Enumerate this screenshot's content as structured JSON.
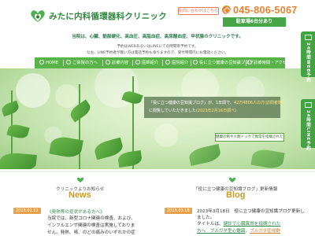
{
  "header": {
    "clinic_name": "みたに内科循環器科クリニック",
    "contact_label": "お問い合わせはこちら",
    "phone": "045-806-5067",
    "parking": "駐車場6台分あり",
    "colors": {
      "brand_green": "#2e8a3e",
      "accent_orange": "#e8822e",
      "parking_green": "#48a648"
    }
  },
  "intro": {
    "line1": "当院は、心臓、動脈硬化、高血圧、高脂血症、高尿酸血症、甲状腺のクリニックです。",
    "line2": "予約はWEBあるいはLINEにての時間帯予約です。",
    "line3": "なお、LINE予約者が無い方は電話予約も承りますので、受付時間内にお電話ください。"
  },
  "nav": {
    "items": [
      {
        "label": "HOME",
        "icon": "home-icon"
      },
      {
        "label": "ご来院の方へ",
        "icon": "person-icon"
      },
      {
        "label": "診療内容",
        "icon": "stethoscope-icon"
      },
      {
        "label": "医師紹介",
        "icon": "doctor-icon"
      },
      {
        "label": "医院紹介",
        "icon": "building-icon"
      },
      {
        "label": "役に立つ健康の豆知識ブログ",
        "icon": "book-icon"
      },
      {
        "label": "診療時間・アクセス",
        "icon": "clock-icon"
      }
    ]
  },
  "hero": {
    "info_prefix": "「役に立つ健康の豆知識ブログ」が、1年間で、",
    "info_highlight": "42万4806人の方(訪問者数)",
    "info_line2_prefix": "に閲覧していただきました",
    "info_line2_highlight": "(2023年2月16日調べ)",
    "ad_text": "健康診断や人間ドックで異常を指摘された方へ"
  },
  "side_tabs": {
    "web_label": "24時間WEB予約",
    "line_label": "24時間LINE予約"
  },
  "news": {
    "subtitle": "クリニックよりお知らせ",
    "title": "News",
    "items": [
      {
        "date": "2023.01.12",
        "headline": "《発熱等の症状がある方へ》",
        "body": [
          "当院では、新型コロナ関連の検査、および、",
          "インフルエンザ関連の検査は実施しておりま",
          "せん。発熱、咳、のどの痛みのいずれかの症"
        ]
      }
    ]
  },
  "blog": {
    "subtitle": "「役に立つ健康の豆知識ブログ」更新情報",
    "title": "Blog",
    "items": [
      {
        "date": "2023.03.18",
        "headline": "2023年3月18日　役に立つ健康の豆知識ブログ更新しました。",
        "title_prefix": "タイトルは、",
        "link1": "健診で心臓異常を指摘された",
        "link2": "方へ　ブルガダ型心電図",
        "link3": "ブルガダ症候群"
      }
    ]
  }
}
